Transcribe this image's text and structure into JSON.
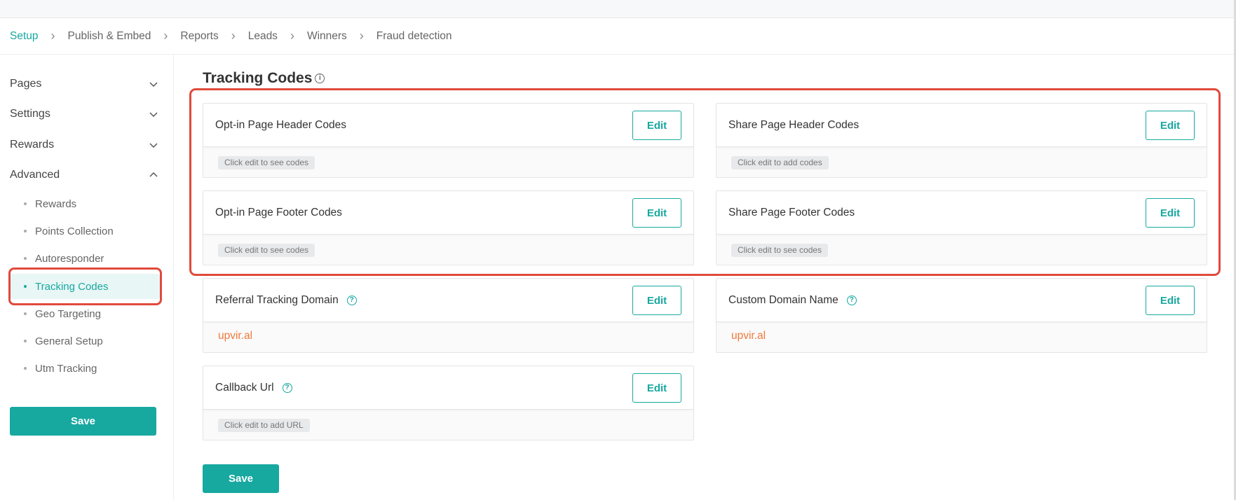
{
  "breadcrumb": [
    "Setup",
    "Publish & Embed",
    "Reports",
    "Leads",
    "Winners",
    "Fraud detection"
  ],
  "sidebar": {
    "sections": [
      {
        "label": "Pages",
        "expanded": false
      },
      {
        "label": "Settings",
        "expanded": false
      },
      {
        "label": "Rewards",
        "expanded": false
      },
      {
        "label": "Advanced",
        "expanded": true
      }
    ],
    "advanced_items": [
      "Rewards",
      "Points Collection",
      "Autoresponder",
      "Tracking Codes",
      "Geo Targeting",
      "General Setup",
      "Utm Tracking"
    ],
    "active_item": "Tracking Codes",
    "save_label": "Save"
  },
  "main": {
    "title": "Tracking Codes",
    "title_icon": "info-icon",
    "cards": [
      {
        "title": "Opt-in Page Header Codes",
        "edit": "Edit",
        "chip": "Click edit to see codes"
      },
      {
        "title": "Share Page Header Codes",
        "edit": "Edit",
        "chip": "Click edit to add codes"
      },
      {
        "title": "Opt-in Page Footer Codes",
        "edit": "Edit",
        "chip": "Click edit to see codes"
      },
      {
        "title": "Share Page Footer Codes",
        "edit": "Edit",
        "chip": "Click edit to see codes"
      },
      {
        "title": "Referral Tracking Domain",
        "edit": "Edit",
        "value": "upvir.al",
        "help_icon": "question-circle-icon"
      },
      {
        "title": "Custom Domain Name",
        "edit": "Edit",
        "value": "upvir.al",
        "help_icon": "question-circle-icon"
      },
      {
        "title": "Callback Url",
        "edit": "Edit",
        "chip": "Click edit to add URL",
        "help_icon": "question-circle-icon"
      }
    ],
    "save_label": "Save"
  },
  "colors": {
    "accent": "#17a8a0",
    "highlight": "#e04a3c",
    "domain_text": "#f07a3c"
  }
}
